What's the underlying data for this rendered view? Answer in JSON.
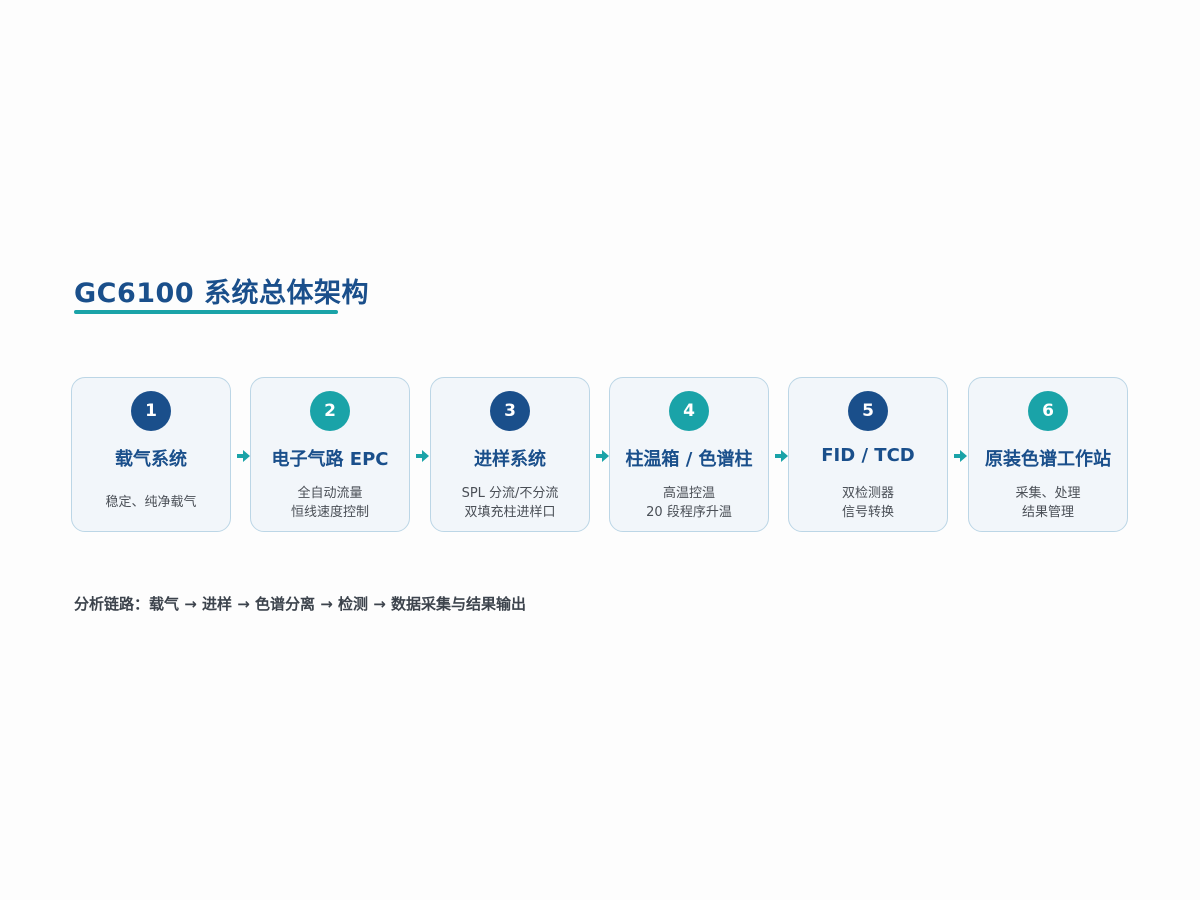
{
  "title": "GC6100 系统总体架构",
  "colors": {
    "navy": "#1a4f8b",
    "teal": "#1aa3a8",
    "card_bg": "#f2f6fa",
    "card_border": "#bcd6e6",
    "caption": "#3c434c"
  },
  "steps": [
    {
      "number": "1",
      "title": "载气系统",
      "lines": [
        "稳定、纯净载气"
      ],
      "badge_color": "navy"
    },
    {
      "number": "2",
      "title": "电子气路 EPC",
      "lines": [
        "全自动流量",
        "恒线速度控制"
      ],
      "badge_color": "teal"
    },
    {
      "number": "3",
      "title": "进样系统",
      "lines": [
        "SPL 分流/不分流",
        "双填充柱进样口"
      ],
      "badge_color": "navy"
    },
    {
      "number": "4",
      "title": "柱温箱 / 色谱柱",
      "lines": [
        "高温控温",
        "20 段程序升温"
      ],
      "badge_color": "teal"
    },
    {
      "number": "5",
      "title": "FID / TCD",
      "lines": [
        "双检测器",
        "信号转换"
      ],
      "badge_color": "navy"
    },
    {
      "number": "6",
      "title": "原装色谱工作站",
      "lines": [
        "采集、处理",
        "结果管理"
      ],
      "badge_color": "teal"
    }
  ],
  "arrow_icon": "right-arrow-icon",
  "caption": "分析链路：载气 → 进样 → 色谱分离 → 检测 → 数据采集与结果输出"
}
